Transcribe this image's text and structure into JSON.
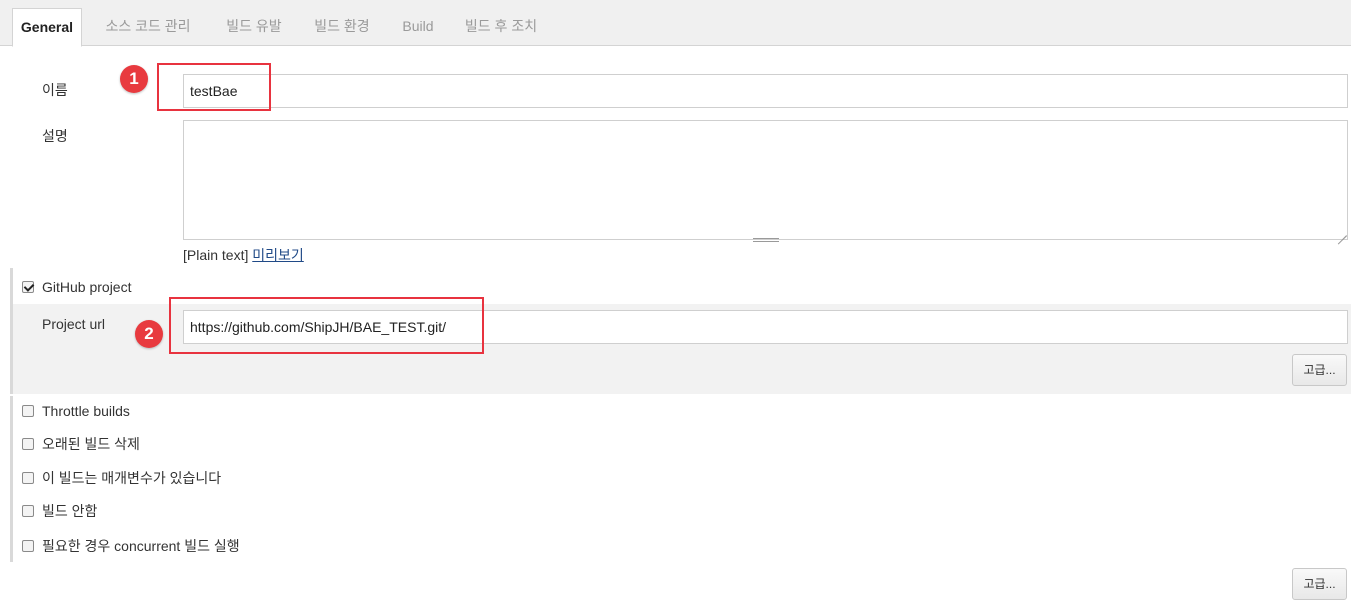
{
  "tabs": [
    {
      "label": "General",
      "active": true
    },
    {
      "label": "소스 코드 관리",
      "active": false
    },
    {
      "label": "빌드 유발",
      "active": false
    },
    {
      "label": "빌드 환경",
      "active": false
    },
    {
      "label": "Build",
      "active": false
    },
    {
      "label": "빌드 후 조치",
      "active": false
    }
  ],
  "general": {
    "name_label": "이름",
    "name_value": "testBae",
    "description_label": "설명",
    "description_value": "",
    "preview_prefix": "[Plain text]",
    "preview_link": "미리보기"
  },
  "github": {
    "checkbox_label": "GitHub project",
    "checked": true,
    "project_url_label": "Project url",
    "project_url_value": "https://github.com/ShipJH/BAE_TEST.git/",
    "advanced_label": "고급..."
  },
  "options": [
    {
      "label": "Throttle builds",
      "checked": false
    },
    {
      "label": "오래된 빌드 삭제",
      "checked": false
    },
    {
      "label": "이 빌드는 매개변수가 있습니다",
      "checked": false
    },
    {
      "label": "빌드 안함",
      "checked": false
    },
    {
      "label": "필요한 경우 concurrent 빌드 실행",
      "checked": false
    }
  ],
  "bottom_advanced_label": "고급...",
  "annotations": {
    "badge_1": "1",
    "badge_2": "2",
    "highlight_color": "#e8333f"
  }
}
